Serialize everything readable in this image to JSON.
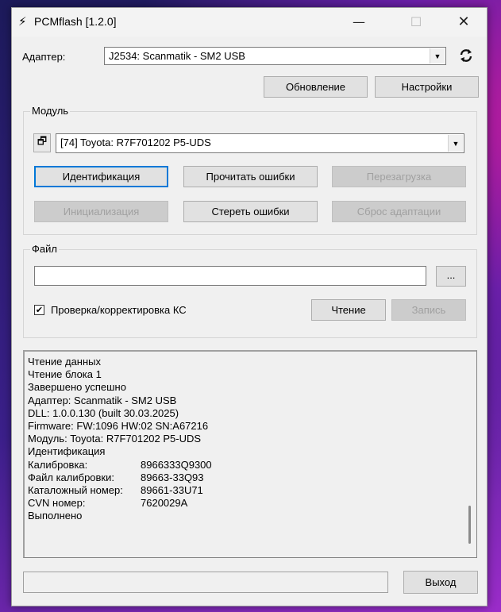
{
  "window": {
    "title": "PCMflash [1.2.0]",
    "minimize": "—",
    "maximize": "☐",
    "close": "✕"
  },
  "adapter": {
    "label": "Адаптер:",
    "selected": "J2534: Scanmatik - SM2 USB",
    "refresh_icon": "refresh-icon"
  },
  "top_buttons": {
    "update": "Обновление",
    "settings": "Настройки"
  },
  "module": {
    "group_title": "Модуль",
    "selected": "[74] Toyota: R7F701202 P5-UDS",
    "buttons": {
      "identify": "Идентификация",
      "read_errors": "Прочитать ошибки",
      "reboot": "Перезагрузка",
      "init": "Инициализация",
      "clear_errors": "Стереть ошибки",
      "reset_adapt": "Сброс адаптации"
    }
  },
  "file": {
    "group_title": "Файл",
    "path_value": "",
    "browse": "...",
    "checksum_label": "Проверка/корректировка КС",
    "checksum_checked": true,
    "read": "Чтение",
    "write": "Запись"
  },
  "log": {
    "lines": [
      "Чтение данных",
      "Чтение блока 1",
      "Завершено успешно",
      "Адаптер: Scanmatik - SM2 USB",
      "DLL: 1.0.0.130 (built 30.03.2025)",
      "Firmware: FW:1096 HW:02 SN:A67216",
      "Модуль: Toyota: R7F701202 P5-UDS",
      "Идентификация"
    ],
    "fields": [
      {
        "key": "Калибровка:",
        "value": "8966333Q9300"
      },
      {
        "key": "Файл калибровки:",
        "value": "89663-33Q93"
      },
      {
        "key": "Каталожный номер:",
        "value": "89661-33U71"
      },
      {
        "key": "CVN номер:",
        "value": "7620029A"
      }
    ],
    "final": "Выполнено"
  },
  "footer": {
    "status_text": "",
    "exit": "Выход"
  }
}
